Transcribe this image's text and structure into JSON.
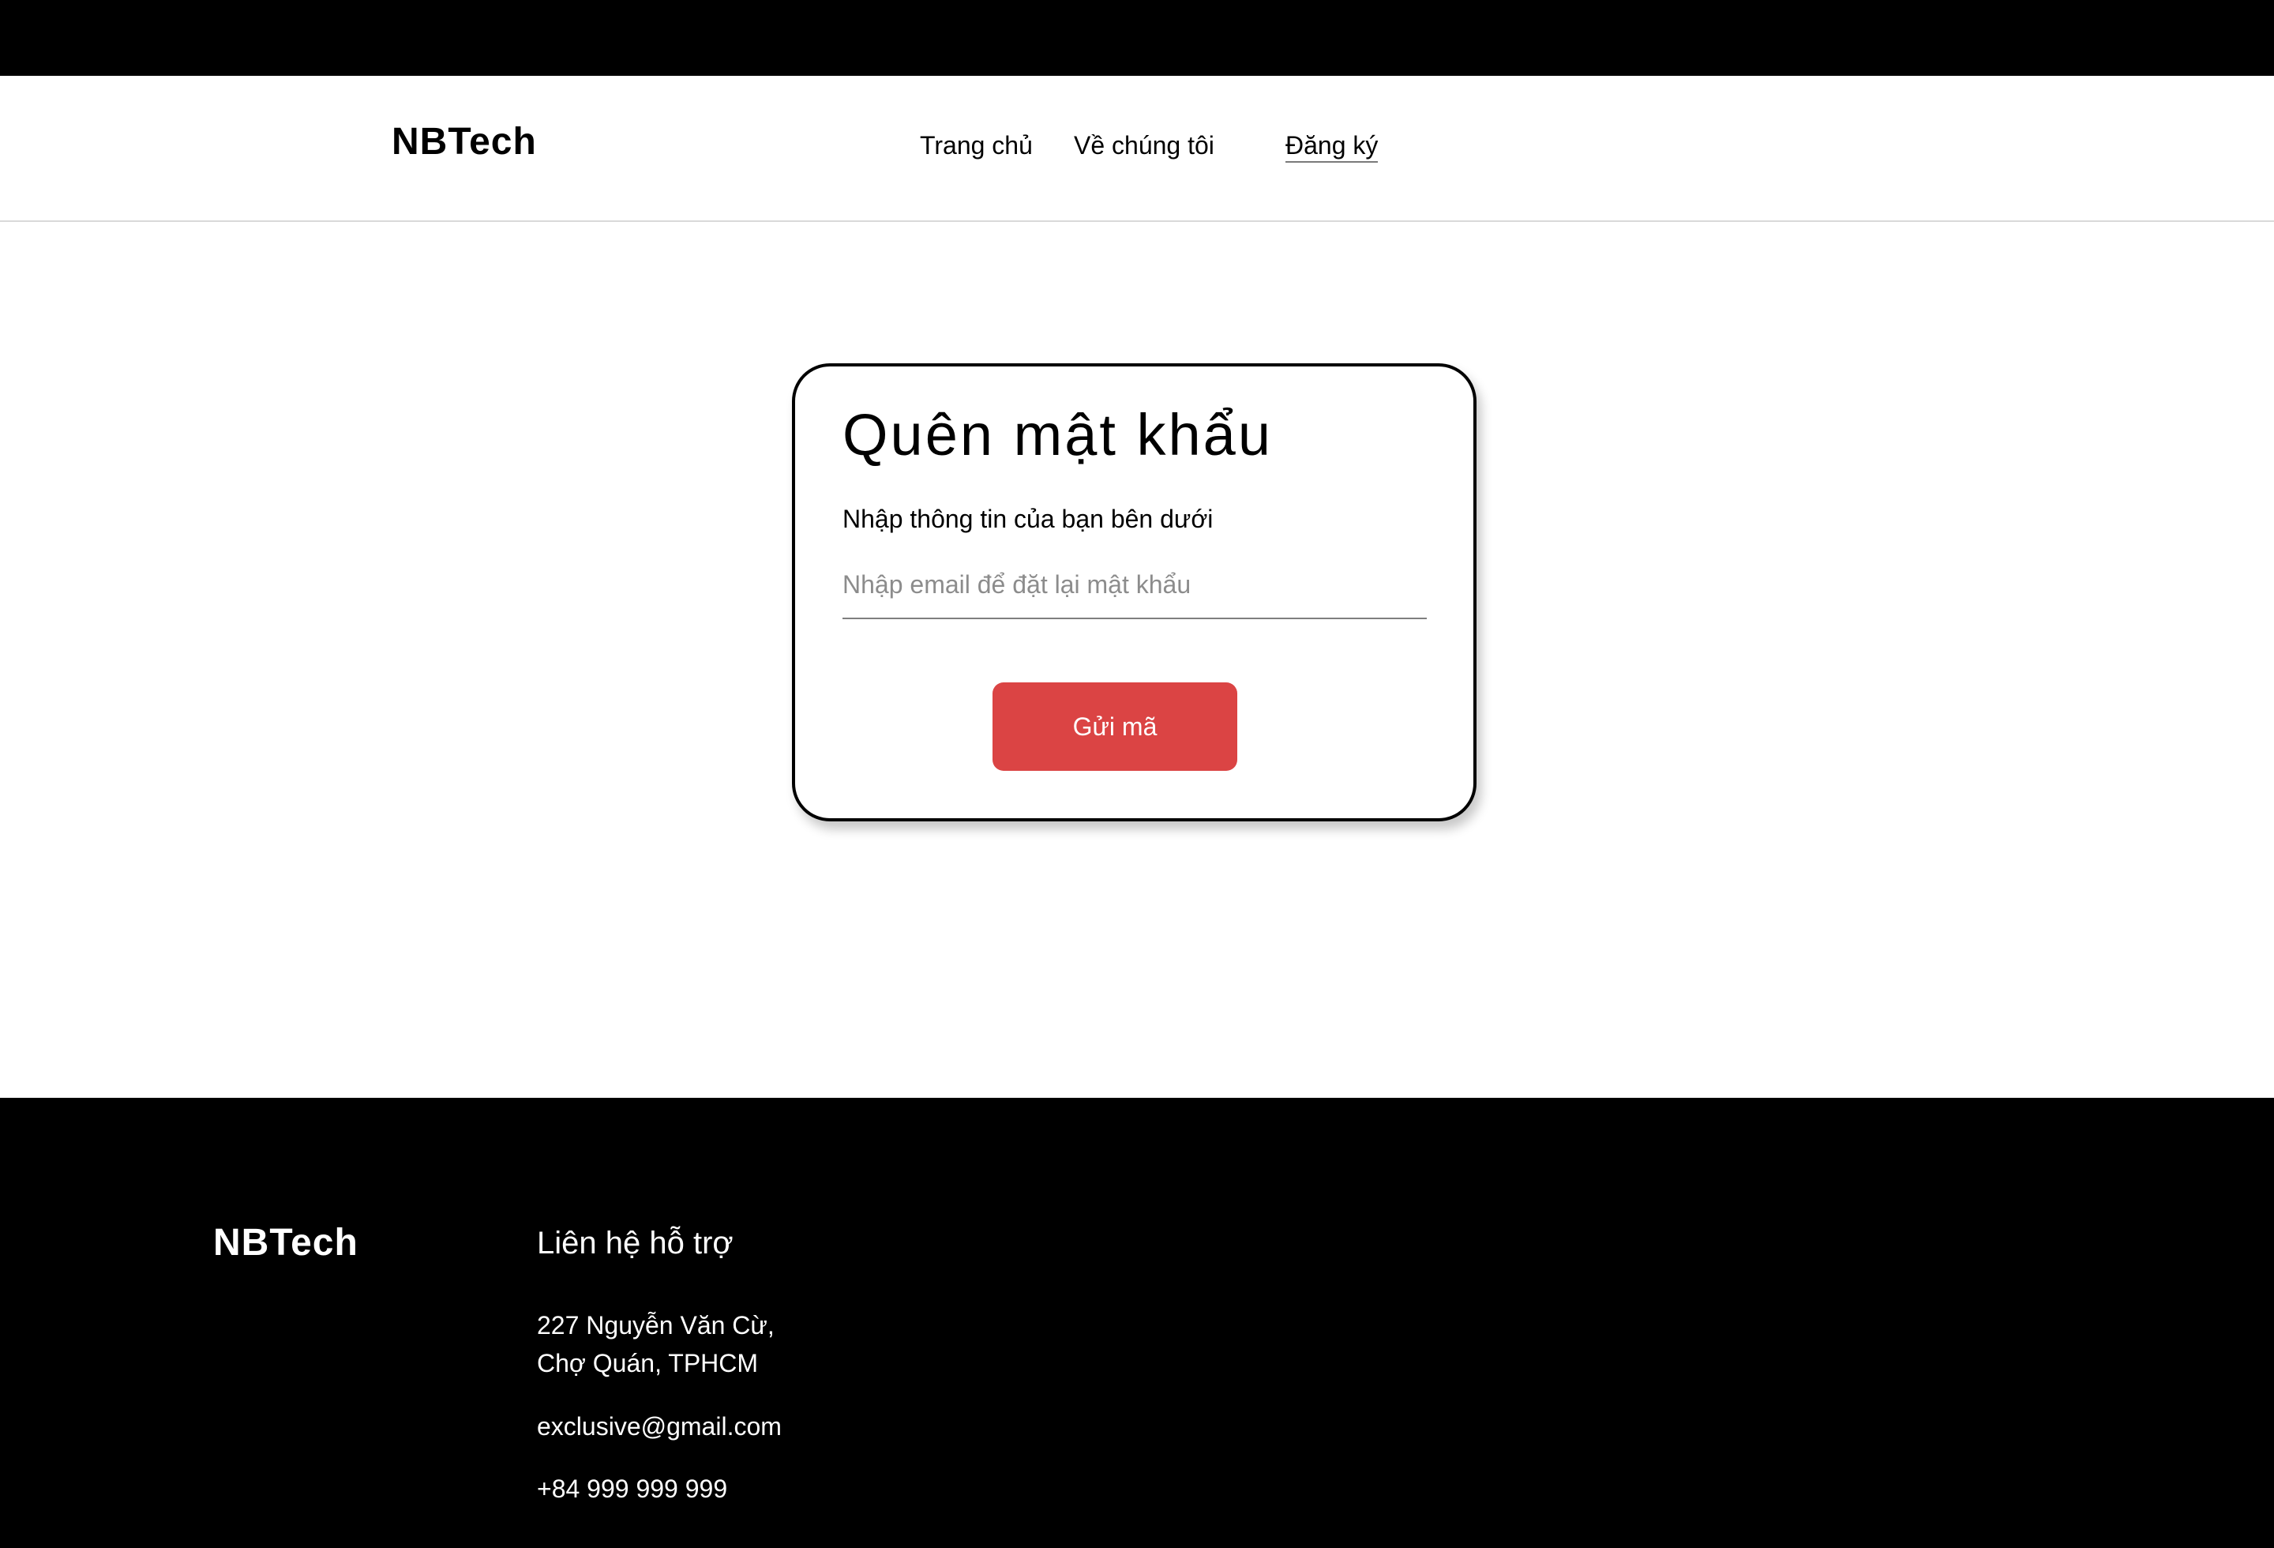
{
  "header": {
    "logo": "NBTech",
    "nav": {
      "home": "Trang chủ",
      "about": "Về chúng tôi",
      "register": "Đăng ký"
    }
  },
  "form": {
    "title": "Quên mật khẩu",
    "subtitle": "Nhập thông tin của bạn bên dưới",
    "email_placeholder": "Nhập email để đặt lại mật khẩu",
    "email_value": "",
    "submit_label": "Gửi mã",
    "submit_color": "#DB4444"
  },
  "footer": {
    "logo": "NBTech",
    "contact_heading": "Liên hệ hỗ trợ",
    "address_line1": "227 Nguyễn Văn Cừ,",
    "address_line2": "Chợ Quán, TPHCM",
    "email": "exclusive@gmail.com",
    "phone": "+84 999 999 999"
  }
}
